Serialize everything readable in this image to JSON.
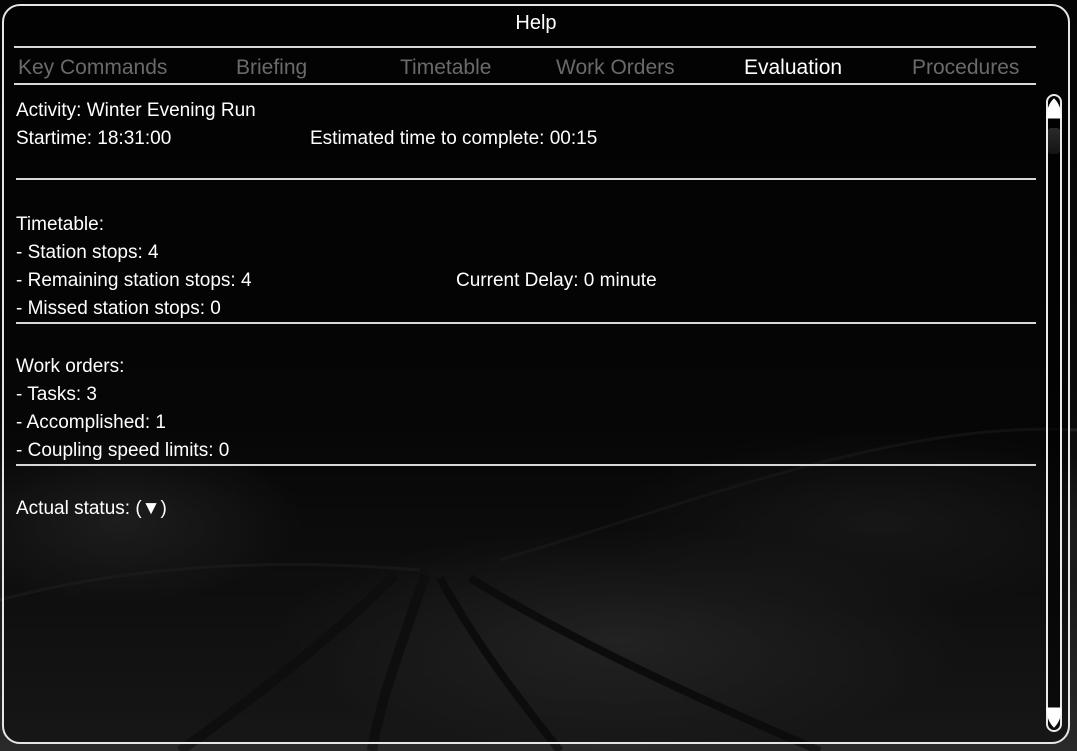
{
  "window": {
    "title": "Help"
  },
  "tabs": [
    {
      "label": "Key Commands"
    },
    {
      "label": "Briefing"
    },
    {
      "label": "Timetable"
    },
    {
      "label": "Work Orders"
    },
    {
      "label": "Evaluation",
      "active": true
    },
    {
      "label": "Procedures"
    }
  ],
  "evaluation": {
    "activity": "Activity: Winter Evening Run",
    "starttime": "Startime: 18:31:00",
    "estimated": "Estimated time to complete: 00:15",
    "timetable": {
      "heading": "Timetable:",
      "station_stops": "- Station stops: 4",
      "remaining_stops": "- Remaining station stops: 4",
      "current_delay": "Current Delay: 0 minute",
      "missed_stops": "- Missed station stops: 0"
    },
    "work_orders": {
      "heading": "Work orders:",
      "tasks": "- Tasks: 3",
      "accomplished": "- Accomplished: 1",
      "coupling_limits": "- Coupling speed limits: 0"
    },
    "actual_status": "Actual status: (▼)"
  },
  "scrollbar": {
    "up_icon": "arrow-up-icon",
    "down_icon": "arrow-down-icon"
  },
  "colors": {
    "active_tab": "#ffffff",
    "inactive_tab": "#6a6a6a",
    "border": "#e6e6e6"
  }
}
